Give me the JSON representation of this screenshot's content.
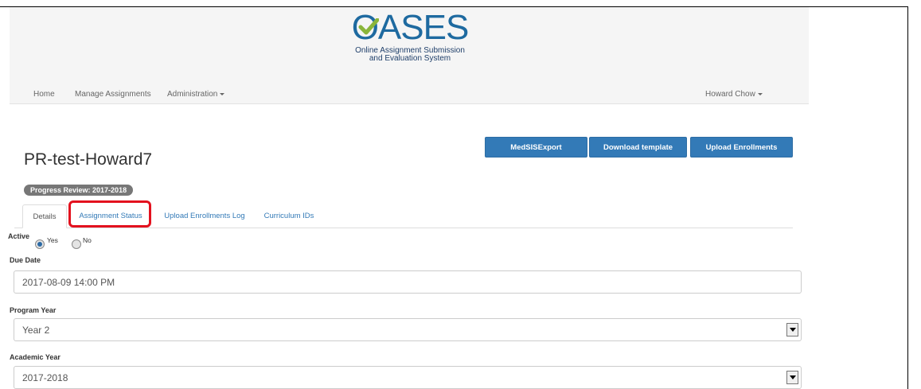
{
  "app": {
    "logo_text": "ASES",
    "subtitle_line1": "Online Assignment Submission",
    "subtitle_line2": "and Evaluation System",
    "brand_color": "#1e6aa0"
  },
  "nav": {
    "home": "Home",
    "manage_assignments": "Manage Assignments",
    "administration": "Administration",
    "user": "Howard Chow"
  },
  "toolbar": {
    "medsis_export": "MedSISExport",
    "download_template": "Download template",
    "upload_enrollments": "Upload Enrollments"
  },
  "page": {
    "title": "PR-test-Howard7",
    "badge": "Progress Review: 2017-2018"
  },
  "tabs": [
    {
      "label": "Details",
      "active": true
    },
    {
      "label": "Assignment Status",
      "active": false
    },
    {
      "label": "Upload Enrollments Log",
      "active": false
    },
    {
      "label": "Curriculum IDs",
      "active": false
    }
  ],
  "form": {
    "active_label": "Active",
    "active_yes": "Yes",
    "active_no": "No",
    "active_value": "Yes",
    "due_date_label": "Due Date",
    "due_date_value": "2017-08-09 14:00 PM",
    "program_year_label": "Program Year",
    "program_year_value": "Year 2",
    "academic_year_label": "Academic Year",
    "academic_year_value": "2017-2018"
  }
}
